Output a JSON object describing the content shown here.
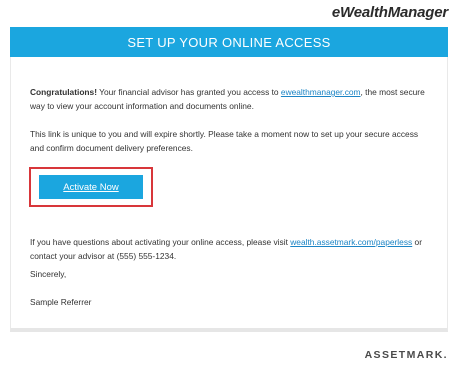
{
  "header": {
    "brand": "eWealthManager",
    "banner_title": "SET UP YOUR ONLINE ACCESS"
  },
  "body": {
    "congrats_bold": "Congratulations!",
    "congrats_text": " Your financial advisor has granted you access to ",
    "congrats_link": "ewealthmanager.com",
    "congrats_text2": ", the most secure way to view your account information and documents online.",
    "unique_text": "This link is unique to you and will expire shortly. Please take a moment now to set up your secure access and confirm document delivery preferences.",
    "activate_label": "Activate Now",
    "questions_text": "If you have questions about activating your online access, please visit ",
    "questions_link": "wealth.assetmark.com/paperless",
    "questions_text2": " or contact your advisor at (555) 555-1234.",
    "closing": "Sincerely,",
    "signature": "Sample Referrer"
  },
  "footer": {
    "logo": "ASSETMARK."
  },
  "colors": {
    "accent": "#1ba6df",
    "highlight": "#d8363a",
    "link": "#1b84c5"
  }
}
